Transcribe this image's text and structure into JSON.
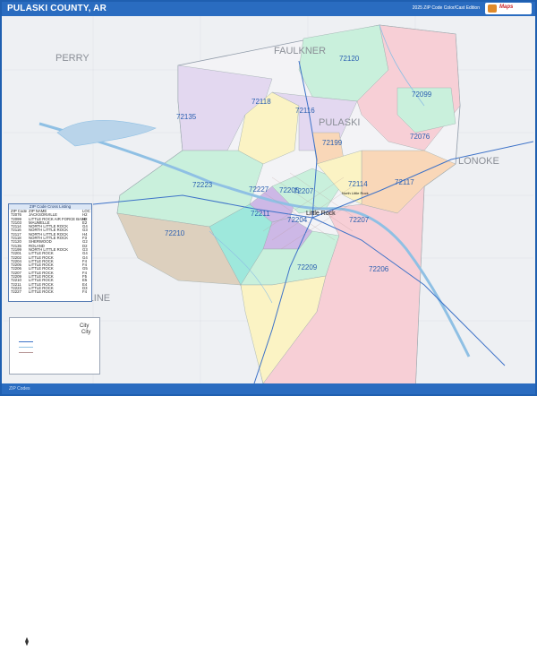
{
  "header": {
    "title": "PULASKI COUNTY, AR",
    "edition": "2025 ZIP Code Color/Cast Edition",
    "logo_text": "Maps"
  },
  "map": {
    "counties": [
      "PERRY",
      "FAULKNER",
      "PULASKI",
      "LONOKE",
      "SALINE"
    ],
    "city_label": "Little Rock",
    "city_label_2": "North Little Rock",
    "zips": {
      "z72120": "72120",
      "z72099": "72099",
      "z72135": "72135",
      "z72116": "72116",
      "z72118": "72118",
      "z72199": "72199",
      "z72076": "72076",
      "z72223": "72223",
      "z72117": "72117",
      "z72210": "72210",
      "z72227": "72227",
      "z72207": "72207",
      "z72211": "72211",
      "z72205": "72205",
      "z72204": "72204",
      "z72206": "72206",
      "z72209": "72209",
      "z72114": "72114"
    },
    "colors": {
      "background": "#eef0f3",
      "water": "#b9d4ea",
      "lavender": "#e3d8f0",
      "pink": "#f7cfd6",
      "mint": "#c9f0dc",
      "yellow": "#fbf3c4",
      "peach": "#f9d7b8",
      "tan": "#ddd0be",
      "teal": "#9ee8dc",
      "purple": "#cdb8e6"
    }
  },
  "legend": {
    "header": "ZIP Code Cross Listing",
    "columns": [
      "ZIP Code",
      "ZIP NAME",
      "LOC"
    ],
    "rows": [
      [
        "72076",
        "JACKSONVILLE",
        "H2"
      ],
      [
        "72099",
        "LITTLE ROCK AIR FORCE BASE",
        "H2"
      ],
      [
        "72103",
        "MAUMELLE",
        "E2"
      ],
      [
        "72114",
        "NORTH LITTLE ROCK",
        "G4"
      ],
      [
        "72116",
        "NORTH LITTLE ROCK",
        "G3"
      ],
      [
        "72117",
        "NORTH LITTLE ROCK",
        "H4"
      ],
      [
        "72118",
        "NORTH LITTLE ROCK",
        "F3"
      ],
      [
        "72120",
        "SHERWOOD",
        "G2"
      ],
      [
        "72135",
        "ROLAND",
        "D2"
      ],
      [
        "72199",
        "NORTH LITTLE ROCK",
        "G3"
      ],
      [
        "72201",
        "LITTLE ROCK",
        "G4"
      ],
      [
        "72202",
        "LITTLE ROCK",
        "G4"
      ],
      [
        "72204",
        "LITTLE ROCK",
        "F4"
      ],
      [
        "72205",
        "LITTLE ROCK",
        "F4"
      ],
      [
        "72206",
        "LITTLE ROCK",
        "G5"
      ],
      [
        "72207",
        "LITTLE ROCK",
        "F4"
      ],
      [
        "72209",
        "LITTLE ROCK",
        "F5"
      ],
      [
        "72210",
        "LITTLE ROCK",
        "E5"
      ],
      [
        "72211",
        "LITTLE ROCK",
        "E4"
      ],
      [
        "72223",
        "LITTLE ROCK",
        "D3"
      ],
      [
        "72227",
        "LITTLE ROCK",
        "F4"
      ]
    ]
  },
  "key": {
    "rows": [
      "City",
      "City"
    ]
  },
  "footer": {
    "text": "ZIP Codes"
  }
}
